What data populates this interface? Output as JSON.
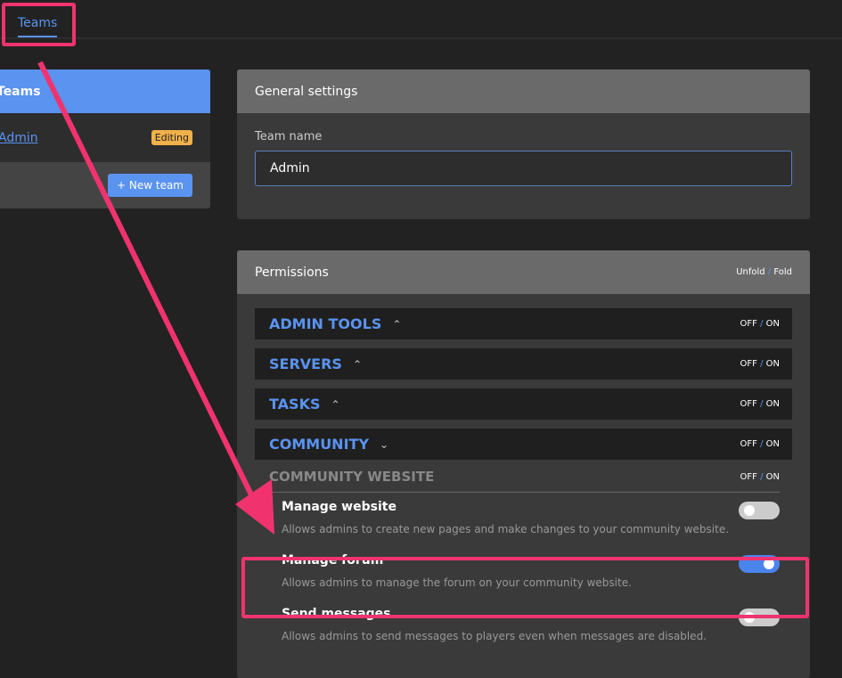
{
  "topbar": {
    "tab_label": "Teams"
  },
  "teams_panel": {
    "header": "Teams",
    "items": [
      {
        "name": "Admin",
        "badge": "Editing"
      }
    ],
    "new_team_label": "+ New team"
  },
  "general_settings": {
    "title": "General settings",
    "team_name_label": "Team name",
    "team_name_value": "Admin"
  },
  "permissions": {
    "title": "Permissions",
    "unfold_label": "Unfold",
    "fold_label": "Fold",
    "off_label": "OFF",
    "on_label": "ON",
    "sections": [
      {
        "title": "ADMIN TOOLS",
        "chevron": "chevron-up-icon",
        "glyph": "⌃"
      },
      {
        "title": "SERVERS",
        "chevron": "chevron-up-icon",
        "glyph": "⌃"
      },
      {
        "title": "TASKS",
        "chevron": "chevron-up-icon",
        "glyph": "⌃"
      },
      {
        "title": "COMMUNITY",
        "chevron": "chevron-down-icon",
        "glyph": "⌄"
      }
    ],
    "subsection": {
      "title": "COMMUNITY WEBSITE",
      "items": [
        {
          "title": "Manage website",
          "description": "Allows admins to create new pages and make changes to your community website.",
          "enabled": false
        },
        {
          "title": "Manage forum",
          "description": "Allows admins to manage the forum on your community website.",
          "enabled": true
        },
        {
          "title": "Send messages",
          "description": "Allows admins to send messages to players even when messages are disabled.",
          "enabled": false
        }
      ]
    }
  },
  "annotation_color": "#f0336f",
  "accent_color": "#5a93f0"
}
